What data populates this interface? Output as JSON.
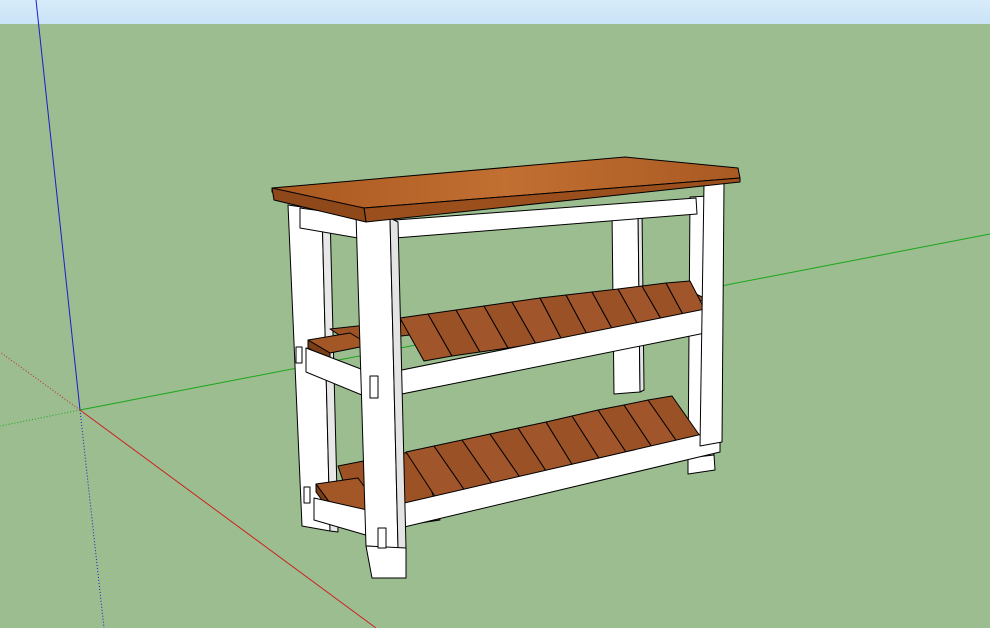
{
  "app": {
    "kind": "3d-modeling-viewport"
  },
  "colors": {
    "sky_top": "#d8ecfa",
    "sky_bottom": "#c9e3f7",
    "ground": "#9bbd8f",
    "axis_blue": "#1c1ccc",
    "axis_red": "#cc2222",
    "axis_green": "#1aa61a",
    "frame_white": "#ffffff",
    "frame_shade": "#e6e6e6",
    "wood_top": "#b3632a",
    "wood_top_light": "#c9783a",
    "wood_slat": "#9c5224",
    "wood_slat_dark": "#7a3e18",
    "edge": "#000000"
  },
  "model": {
    "name": "console-table-with-slatted-shelves",
    "shelves": 2,
    "slats_per_shelf": 12
  }
}
